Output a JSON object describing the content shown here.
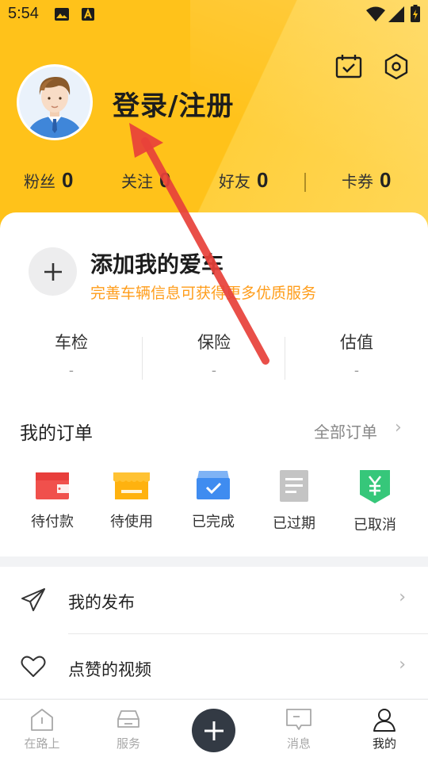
{
  "status_bar": {
    "time": "5:54"
  },
  "profile": {
    "login_label": "登录/注册"
  },
  "stats": [
    {
      "label": "粉丝",
      "value": "0"
    },
    {
      "label": "关注",
      "value": "0"
    },
    {
      "label": "好友",
      "value": "0"
    },
    {
      "label": "卡券",
      "value": "0"
    }
  ],
  "add_car": {
    "title": "添加我的爱车",
    "subtitle": "完善车辆信息可获得更多优质服务"
  },
  "car_stats": [
    {
      "label": "车检",
      "value": "-"
    },
    {
      "label": "保险",
      "value": "-"
    },
    {
      "label": "估值",
      "value": "-"
    }
  ],
  "orders": {
    "title": "我的订单",
    "all_label": "全部订单",
    "items": [
      {
        "label": "待付款",
        "icon": "wallet-icon"
      },
      {
        "label": "待使用",
        "icon": "shop-icon"
      },
      {
        "label": "已完成",
        "icon": "box-check-icon"
      },
      {
        "label": "已过期",
        "icon": "document-icon"
      },
      {
        "label": "已取消",
        "icon": "yen-shield-icon"
      }
    ]
  },
  "menu": [
    {
      "label": "我的发布",
      "icon": "paper-plane-icon"
    },
    {
      "label": "点赞的视频",
      "icon": "heart-icon"
    }
  ],
  "tabbar": [
    {
      "label": "在路上",
      "icon": "road-icon",
      "active": false
    },
    {
      "label": "服务",
      "icon": "car-icon",
      "active": false
    },
    {
      "label": "消息",
      "icon": "message-icon",
      "active": false
    },
    {
      "label": "我的",
      "icon": "person-icon",
      "active": true
    }
  ],
  "colors": {
    "header_yellow": "#ffc21a",
    "accent_orange": "#ff9d1b",
    "arrow_red": "#e8413a",
    "tab_add_bg": "#333a44"
  }
}
